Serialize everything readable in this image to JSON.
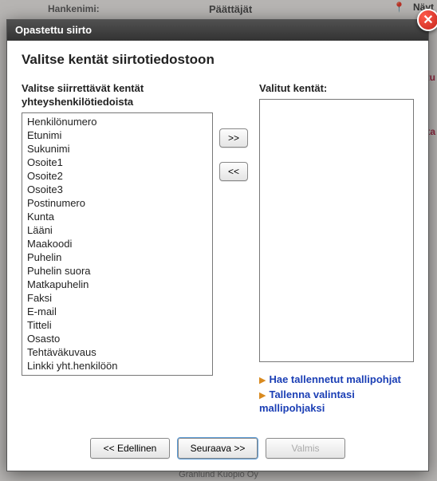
{
  "backdrop": {
    "label_left": "Hankenimi:",
    "label_mid": "Päättäjät",
    "nayt_fragment": "Näyt",
    "tu_fragment": "tu",
    "ta_fragment": "ta",
    "footer_fragment": "Granlund Kuopio Oy"
  },
  "dialog": {
    "title": "Opastettu siirto",
    "close_glyph": "✕",
    "heading": "Valitse kentät siirtotiedostoon",
    "available_label": "Valitse siirrettävät kentät yhteyshenkilötiedoista",
    "selected_label": "Valitut kentät:",
    "available_fields": [
      "Henkilönumero",
      "Etunimi",
      "Sukunimi",
      "Osoite1",
      "Osoite2",
      "Osoite3",
      "Postinumero",
      "Kunta",
      "Lääni",
      "Maakoodi",
      "Puhelin",
      "Puhelin suora",
      "Matkapuhelin",
      "Faksi",
      "E-mail",
      "Titteli",
      "Osasto",
      "Tehtäväkuvaus",
      "Linkki yht.henkilöön"
    ],
    "selected_fields": [],
    "add_btn": ">>",
    "remove_btn": "<<",
    "link_load": "Hae tallennetut mallipohjat",
    "link_save": "Tallenna valintasi mallipohjaksi",
    "btn_prev": "<< Edellinen",
    "btn_next": "Seuraava >>",
    "btn_finish": "Valmis"
  }
}
